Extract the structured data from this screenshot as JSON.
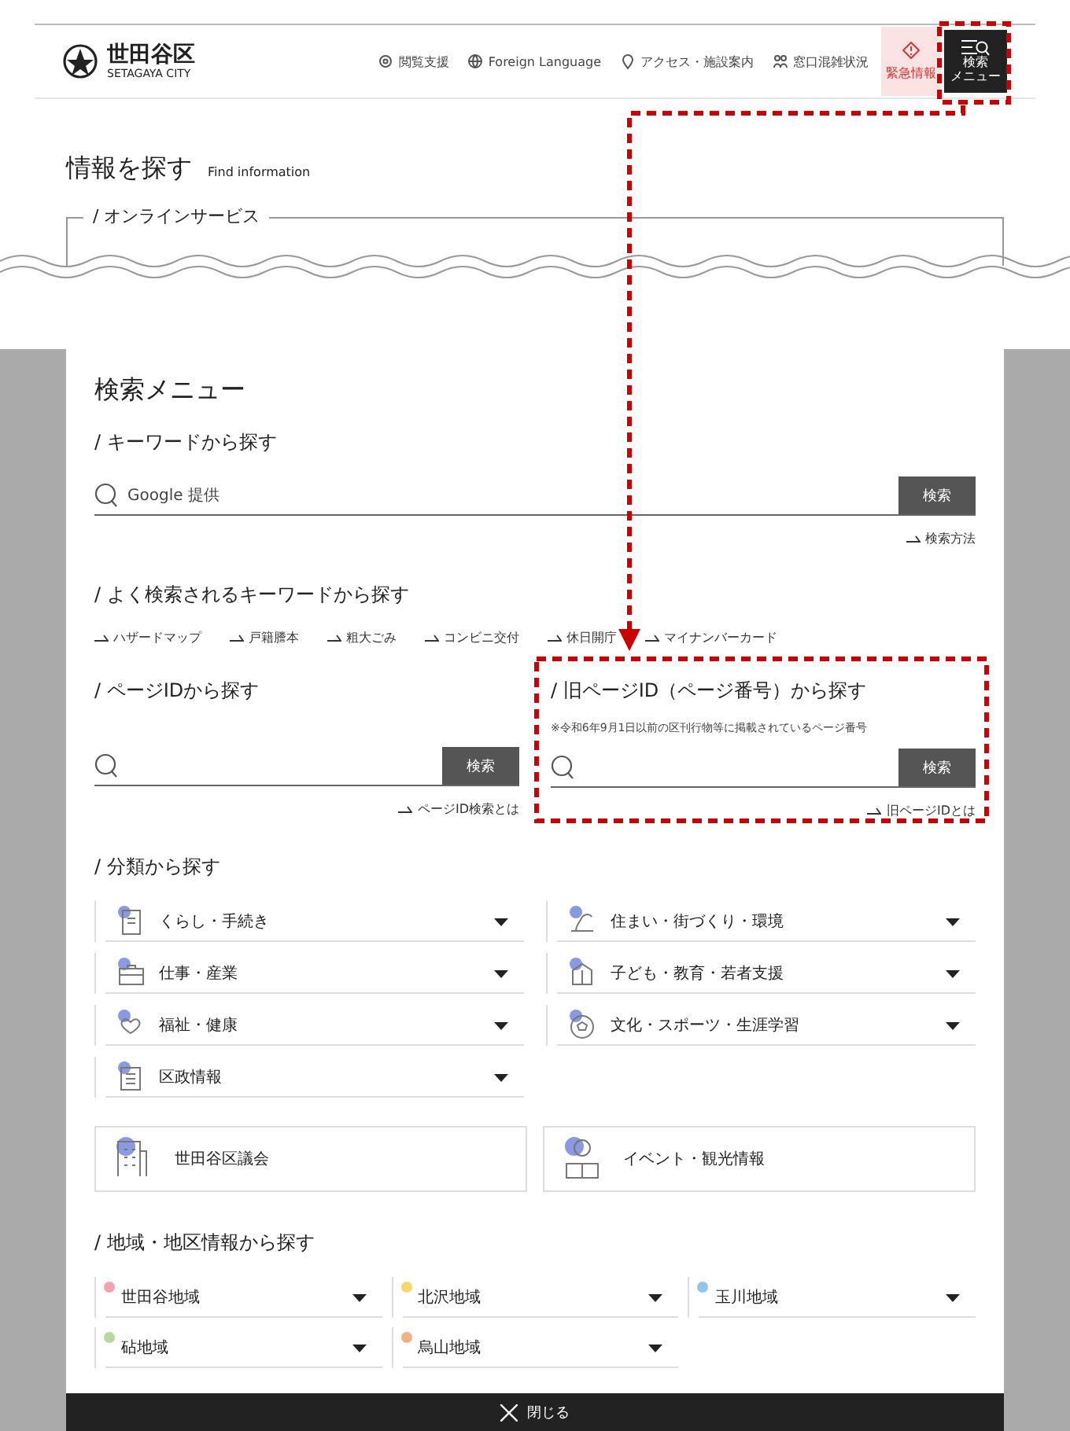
{
  "header": {
    "logo": {
      "name": "世田谷区",
      "sub": "SETAGAYA CITY"
    },
    "links": [
      {
        "label": "閲覧支援"
      },
      {
        "label": "Foreign Language"
      },
      {
        "label": "アクセス・施設案内"
      },
      {
        "label": "窓口混雑状況"
      }
    ],
    "emergency": {
      "label": "緊急情報"
    },
    "search_menu_button": {
      "lines": [
        "検索",
        "メニュー"
      ]
    }
  },
  "page": {
    "title": "情報を探す",
    "subtitle": "Find information",
    "section": "/ オンラインサービス"
  },
  "search_menu": {
    "title": "検索メニュー",
    "keyword": {
      "heading": "/ キーワードから探す",
      "placeholder": "Google 提供",
      "button": "検索",
      "link": "検索方法"
    },
    "popular": {
      "heading": "/ よく検索されるキーワードから探す",
      "keywords": [
        "ハザードマップ",
        "戸籍謄本",
        "粗大ごみ",
        "コンビニ交付",
        "休日開庁",
        "マイナンバーカード"
      ]
    },
    "page_id": {
      "heading": "/ ページIDから探す",
      "button": "検索",
      "link": "ページID検索とは"
    },
    "old_page_id": {
      "heading": "/ 旧ページID（ページ番号）から探す",
      "note": "※令和6年9月1日以前の区刊行物等に掲載されているページ番号",
      "button": "検索",
      "link": "旧ページIDとは"
    },
    "categories": {
      "heading": "/ 分類から探す",
      "items": [
        {
          "label": "くらし・手続き",
          "expanded": false
        },
        {
          "label": "住まい・街づくり・環境",
          "expanded": false
        },
        {
          "label": "仕事・産業",
          "expanded": false
        },
        {
          "label": "子ども・教育・若者支援",
          "expanded": false
        },
        {
          "label": "福祉・健康",
          "expanded": false
        },
        {
          "label": "文化・スポーツ・生涯学習",
          "expanded": false
        },
        {
          "label": "区政情報",
          "expanded": false
        }
      ],
      "cards": [
        {
          "label": "世田谷区議会"
        },
        {
          "label": "イベント・観光情報"
        }
      ]
    },
    "regions": {
      "heading": "/ 地域・地区情報から探す",
      "items": [
        {
          "label": "世田谷地域",
          "color": "#f2a3ab",
          "expanded": false
        },
        {
          "label": "北沢地域",
          "color": "#f3d96b",
          "expanded": false
        },
        {
          "label": "玉川地域",
          "color": "#8fc6ea",
          "expanded": false
        },
        {
          "label": "砧地域",
          "color": "#b6da9c",
          "expanded": false
        },
        {
          "label": "烏山地域",
          "color": "#f2b283",
          "expanded": false
        }
      ]
    },
    "close_button": "閉じる"
  }
}
